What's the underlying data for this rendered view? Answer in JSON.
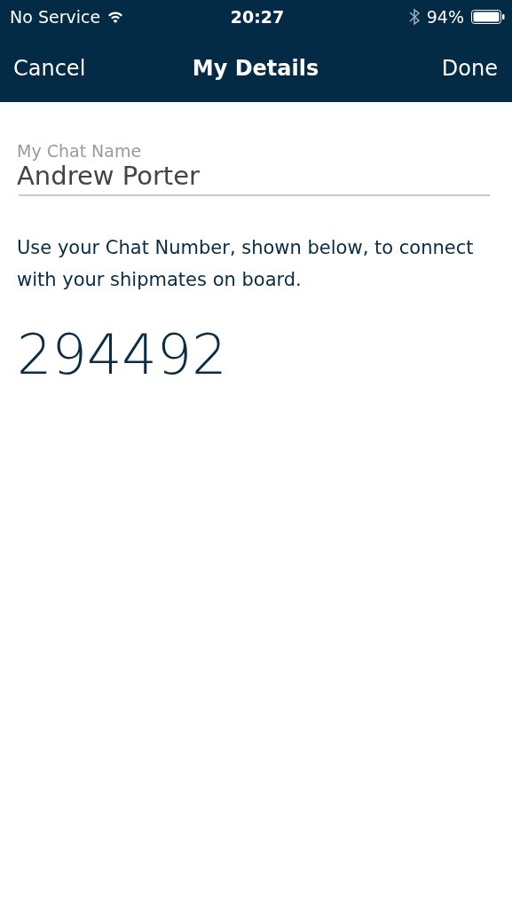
{
  "status_bar": {
    "carrier": "No Service",
    "time": "20:27",
    "battery": "94%"
  },
  "nav_bar": {
    "left": "Cancel",
    "title": "My Details",
    "right": "Done"
  },
  "name_field": {
    "label": "My Chat Name",
    "value": "Andrew Porter"
  },
  "info": "Use your Chat Number, shown below, to connect with your shipmates on board.",
  "chat_number": "294492"
}
